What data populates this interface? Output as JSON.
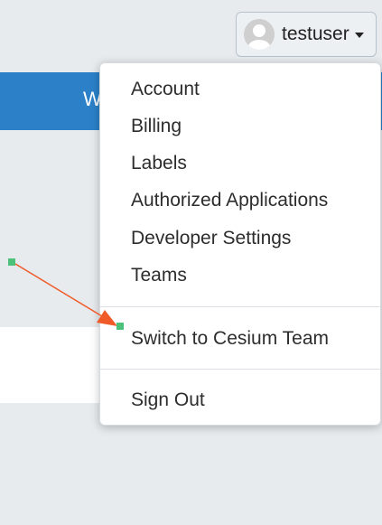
{
  "header": {
    "username": "testuser"
  },
  "banner": {
    "partial_text": "W"
  },
  "menu": {
    "items": [
      {
        "label": "Account"
      },
      {
        "label": "Billing"
      },
      {
        "label": "Labels"
      },
      {
        "label": "Authorized Applications"
      },
      {
        "label": "Developer Settings"
      },
      {
        "label": "Teams"
      }
    ],
    "switch_team": {
      "label": "Switch to Cesium Team"
    },
    "sign_out": {
      "label": "Sign Out"
    }
  },
  "colors": {
    "banner": "#2b80c8",
    "arrow": "#f05a28",
    "marker": "#4cc17a"
  },
  "icons": {
    "avatar": "user-avatar-icon",
    "caret": "caret-down-icon",
    "annotation": "arrow-icon"
  }
}
